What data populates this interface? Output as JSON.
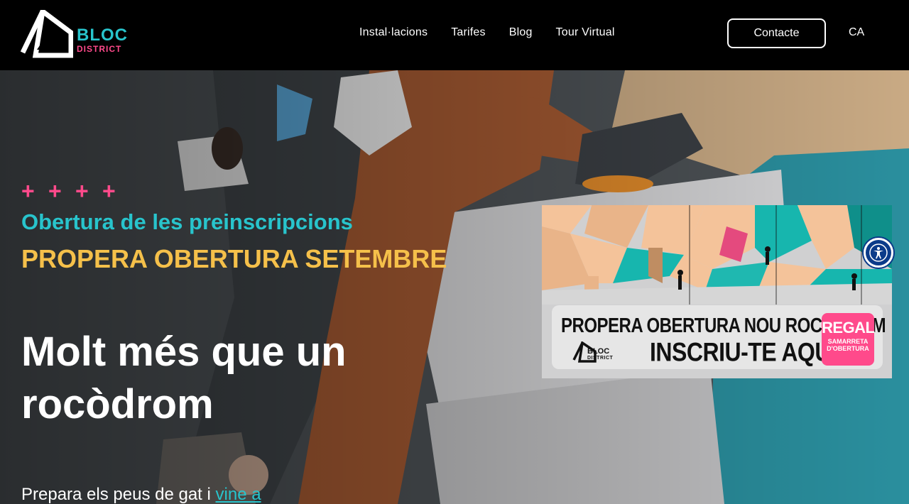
{
  "header": {
    "logo": {
      "primary": "BLOC",
      "secondary": "DISTRICT"
    },
    "nav": [
      "Instal·lacions",
      "Tarifes",
      "Blog",
      "Tour Virtual"
    ],
    "contact_label": "Contacte",
    "language": "CA"
  },
  "hero": {
    "subtitle_cyan": "Obertura de les preinscripcions",
    "subtitle_yellow": "PROPERA OBERTURA SETEMBRE",
    "title": "Molt més que un rocòdrom",
    "text_prefix": "Prepara els peus de gat i ",
    "text_link": "vine a"
  },
  "banner": {
    "line1": "PROPERA OBERTURA NOU ROCÒDROM",
    "line2": "INSCRIU-TE AQUÍ",
    "logo_primary": "BLOC",
    "logo_secondary": "DISTRICT",
    "gift_big": "REGAL",
    "gift_small": "SAMARRETA D'OBERTURA"
  },
  "accessibility_icon": "accessibility-icon",
  "colors": {
    "cyan": "#28c4cc",
    "pink": "#ff4a8b",
    "yellow": "#f5c04a",
    "header_bg": "#000000"
  }
}
